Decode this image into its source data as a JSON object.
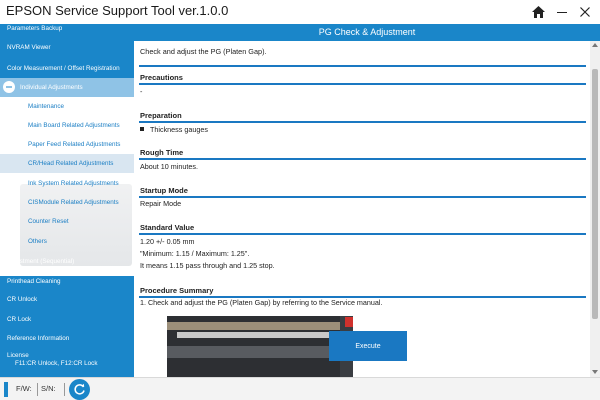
{
  "app": {
    "title": "EPSON Service Support Tool  ver.1.0.0"
  },
  "titlebar": {
    "home_icon": "home-icon",
    "minimize_icon": "minimize-icon",
    "close_icon": "close-icon"
  },
  "sidebar": {
    "items": [
      {
        "label": "Parameters Backup"
      },
      {
        "label": "NVRAM Viewer"
      },
      {
        "label": "Color Measurement / Offset Registration"
      },
      {
        "label": "Individual Adjustments",
        "expanded": true
      },
      {
        "label": "Maintenance"
      },
      {
        "label": "Main Board Related Adjustments"
      },
      {
        "label": "Paper Feed Related Adjustments"
      },
      {
        "label": "CR/Head Related Adjustments",
        "selected": true
      },
      {
        "label": "Ink System Related Adjustments"
      },
      {
        "label": "CISModule Related Adjustments"
      },
      {
        "label": "Counter Reset"
      },
      {
        "label": "Others"
      },
      {
        "label": "Adjustment (Sequential)"
      },
      {
        "label": "Printhead Cleaning"
      },
      {
        "label": "CR Unlock"
      },
      {
        "label": "CR Lock"
      },
      {
        "label": "Reference Information"
      },
      {
        "label": "License",
        "sublabel": "F11:CR Unlock, F12:CR Lock"
      }
    ]
  },
  "main": {
    "header": "PG Check & Adjustment",
    "intro": "Check and adjust the PG (Platen Gap).",
    "sections": [
      {
        "title": "Precautions",
        "lines": [
          "-"
        ]
      },
      {
        "title": "Preparation",
        "lines": [
          "Thickness gauges"
        ]
      },
      {
        "title": "Rough Time",
        "lines": [
          "About 10 minutes."
        ]
      },
      {
        "title": "Startup Mode",
        "lines": [
          "Repair Mode"
        ]
      },
      {
        "title": "Standard Value",
        "lines": [
          "1.20 +/- 0.05 mm",
          "\"Minimum: 1.15 / Maximum: 1.25\".",
          "It means 1.15 pass through and 1.25 stop."
        ]
      },
      {
        "title": "Procedure Summary",
        "lines": [
          "1.  Check and adjust the PG (Platen Gap) by referring to the Service manual."
        ]
      }
    ],
    "execute_label": "Execute"
  },
  "statusbar": {
    "fw_label": "F/W:",
    "sn_label": "S/N:",
    "refresh_icon": "refresh-icon"
  },
  "colors": {
    "accent": "#1a86c9",
    "active_parent": "#8fc3e6",
    "selected_item": "#d9e6f1"
  }
}
